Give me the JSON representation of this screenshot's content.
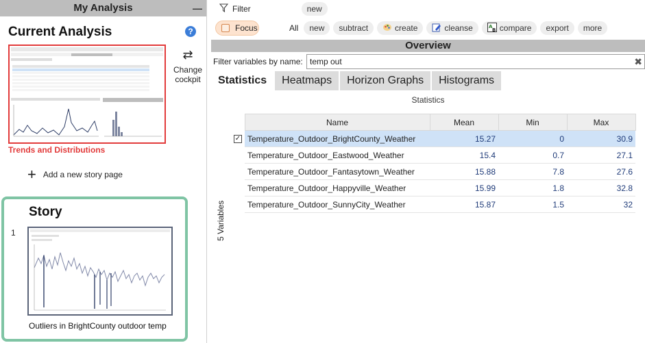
{
  "left_panel": {
    "header_title": "My Analysis",
    "minimize_label": "—",
    "current_analysis_title": "Current Analysis",
    "help_label": "?",
    "thumbnail_caption": "Trends and Distributions",
    "change_cockpit_label": "Change cockpit",
    "add_story_label": "Add a new story page",
    "story": {
      "title": "Story",
      "page_number": "1",
      "page_caption": "Outliers in BrightCounty outdoor temp"
    }
  },
  "toolbar": {
    "filter_label": "Filter",
    "filter_new_label": "new",
    "focus_label": "Focus",
    "all_label": "All",
    "actions": [
      {
        "label": "new",
        "icon": null
      },
      {
        "label": "subtract",
        "icon": null
      },
      {
        "label": "create",
        "icon": "palette-icon"
      },
      {
        "label": "cleanse",
        "icon": "edit-icon"
      },
      {
        "label": "compare",
        "icon": "compare-ab-icon"
      },
      {
        "label": "export",
        "icon": null
      },
      {
        "label": "more",
        "icon": null
      }
    ]
  },
  "overview": {
    "title": "Overview",
    "filter_by_name_label": "Filter variables by name:",
    "filter_value": "temp out",
    "tabs": [
      {
        "label": "Statistics",
        "active": true
      },
      {
        "label": "Heatmaps",
        "active": false
      },
      {
        "label": "Horizon Graphs",
        "active": false
      },
      {
        "label": "Histograms",
        "active": false
      }
    ],
    "statistics_caption": "Statistics",
    "variables_count_label": "5 Variables",
    "table": {
      "columns": [
        "Name",
        "Mean",
        "Min",
        "Max"
      ],
      "rows": [
        {
          "name": "Temperature_Outdoor_BrightCounty_Weather",
          "mean": "15.27",
          "min": "0",
          "max": "30.9",
          "selected": true
        },
        {
          "name": "Temperature_Outdoor_Eastwood_Weather",
          "mean": "15.4",
          "min": "0.7",
          "max": "27.1",
          "selected": false
        },
        {
          "name": "Temperature_Outdoor_Fantasytown_Weather",
          "mean": "15.88",
          "min": "7.8",
          "max": "27.6",
          "selected": false
        },
        {
          "name": "Temperature_Outdoor_Happyville_Weather",
          "mean": "15.99",
          "min": "1.8",
          "max": "32.8",
          "selected": false
        },
        {
          "name": "Temperature_Outdoor_SunnyCity_Weather",
          "mean": "15.87",
          "min": "1.5",
          "max": "32",
          "selected": false
        }
      ]
    }
  },
  "colors": {
    "header_gray": "#bdbdbd",
    "thumbnail_border": "#e23a3a",
    "story_border": "#7fc4a4",
    "focus_bg": "#fde3cf",
    "selected_row": "#cfe2f7"
  }
}
